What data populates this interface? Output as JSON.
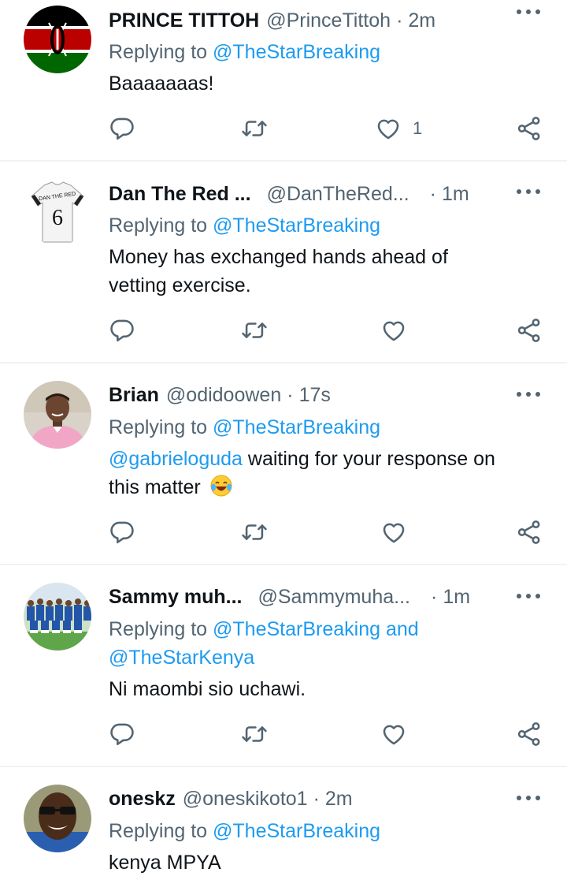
{
  "tweets": [
    {
      "name": "PRINCE TITTOH",
      "handle": "@PrinceTittoh",
      "sep": "·",
      "time": "2m",
      "reply_prefix": "Replying to",
      "reply_to": "@TheStarBreaking",
      "text": "Baaaaaaas!",
      "like_count": "1",
      "avatar": "kenya-flag"
    },
    {
      "name": "Dan The Red ...",
      "handle": "@DanTheRed...",
      "sep": "·",
      "time": "1m",
      "reply_prefix": "Replying to",
      "reply_to": "@TheStarBreaking",
      "text_line1": "Money has exchanged hands ahead of",
      "text_line2": "vetting exercise.",
      "avatar": "jersey-6",
      "jersey_text": "DAN THE RED",
      "jersey_number": "6"
    },
    {
      "name": "Brian",
      "handle": "@odidoowen",
      "sep": "·",
      "time": "17s",
      "reply_prefix": "Replying to",
      "reply_to": "@TheStarBreaking",
      "mention": "@gabrieloguda",
      "text_rest": " waiting for your response on",
      "text_line2": "this matter",
      "emoji": "laughing-face",
      "avatar": "person-photo"
    },
    {
      "name": "Sammy muh...",
      "handle": "@Sammymuha...",
      "sep": "·",
      "time": "1m",
      "reply_prefix": "Replying to",
      "reply_to": "@TheStarBreaking and",
      "reply_to_line2": "@TheStarKenya",
      "text": "Ni maombi sio uchawi.",
      "avatar": "team-photo"
    },
    {
      "name": "oneskz",
      "handle": "@oneskikoto1",
      "sep": "·",
      "time": "2m",
      "reply_prefix": "Replying to",
      "reply_to": "@TheStarBreaking",
      "text": "kenya MPYA",
      "avatar": "person-sunglasses"
    }
  ],
  "icons": {
    "reply": "reply-icon",
    "retweet": "retweet-icon",
    "like": "like-icon",
    "share": "share-icon",
    "more": "more-icon"
  },
  "colors": {
    "link": "#1d9bf0",
    "secondary": "#536471",
    "divider": "#eff3f4"
  }
}
